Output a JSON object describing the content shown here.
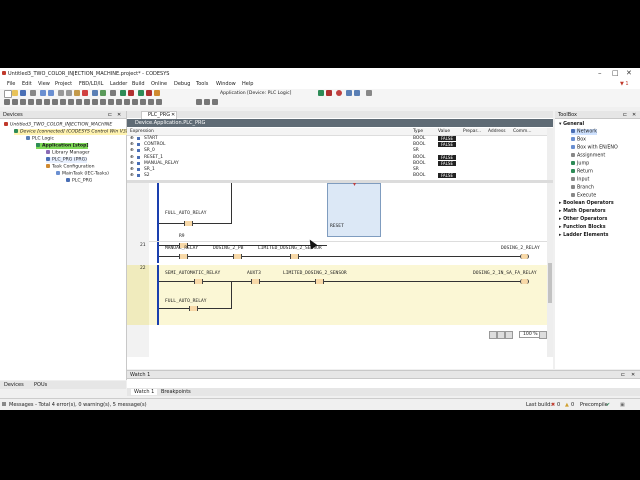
{
  "window": {
    "title": "Untitled3_TWO_COLOR_INJECTION_MACHINE.project* - CODESYS"
  },
  "menu": [
    "File",
    "Edit",
    "View",
    "Project",
    "FBD/LD/IL",
    "Ladder",
    "Build",
    "Online",
    "Debug",
    "Tools",
    "Window",
    "Help"
  ],
  "toolbar": {
    "app_selector": "Application [Device: PLC Logic]"
  },
  "devices": {
    "header": "Devices",
    "items": [
      "Untitled3_TWO_COLOR_INJECTION_MACHINE",
      "Device [connected] (CODESYS Control Win V3)",
      "PLC Logic",
      "Application [stop]",
      "Library Manager",
      "PLC_PRG (PRG)",
      "Task Configuration",
      "MainTask (IEC-Tasks)",
      "PLC_PRG"
    ],
    "tabs": [
      "Devices",
      "POUs"
    ]
  },
  "editor": {
    "tab": "PLC_PRG",
    "path": "Device.Application.PLC_PRG",
    "columns": [
      "Expression",
      "Type",
      "Value",
      "Prepar...",
      "Address",
      "Comm..."
    ],
    "rows": [
      {
        "expr": "START",
        "type": "BOOL",
        "value": "FALSE"
      },
      {
        "expr": "CONTROL",
        "type": "BOOL",
        "value": "FALSE"
      },
      {
        "expr": "SR_0",
        "type": "SR",
        "value": ""
      },
      {
        "expr": "RESET_1",
        "type": "BOOL",
        "value": "FALSE"
      },
      {
        "expr": "MANUAL_RELAY",
        "type": "BOOL",
        "value": "FALSE"
      },
      {
        "expr": "SR_1",
        "type": "SR",
        "value": ""
      },
      {
        "expr": "S2",
        "type": "BOOL",
        "value": "FALSE"
      }
    ],
    "ladder": {
      "l1": "FULL_AUTO_RELAY",
      "l2": "R9",
      "reset": "RESET",
      "rung21": "21",
      "r21_a": "MANUAL_RELAY",
      "r21_b": "DOSING_2_PB",
      "r21_c": "LIMITED_DOSING_2_SENSOR",
      "r21_coil": "DOSING_2_RELAY",
      "rung22": "22",
      "r22_a": "SEMI_AUTOMATIC_RELAY",
      "r22_b": "AUXT3",
      "r22_c": "LIMITED_DOSING_2_SENSOR",
      "r22_coil": "DOSING_2_IN_SA_FA_RELAY",
      "r22_d": "FULL_AUTO_RELAY",
      "zoom": "100 %"
    }
  },
  "toolbox": {
    "header": "ToolBox",
    "general": "General",
    "items": [
      "Network",
      "Box",
      "Box with EN/ENO",
      "Assignment",
      "Jump",
      "Return",
      "Input",
      "Branch",
      "Execute"
    ],
    "groups": [
      "Boolean Operators",
      "Math Operators",
      "Other Operators",
      "Function Blocks",
      "Ladder Elements"
    ]
  },
  "watch": {
    "header": "Watch 1",
    "tabs": [
      "Watch 1",
      "Breakpoints"
    ]
  },
  "status": {
    "messages": "Messages - Total 4 error(s), 0 warning(s), 5 message(s)",
    "last_build": "Last build:",
    "errors": "0",
    "warnings": "0",
    "precompile": "Precompile"
  }
}
